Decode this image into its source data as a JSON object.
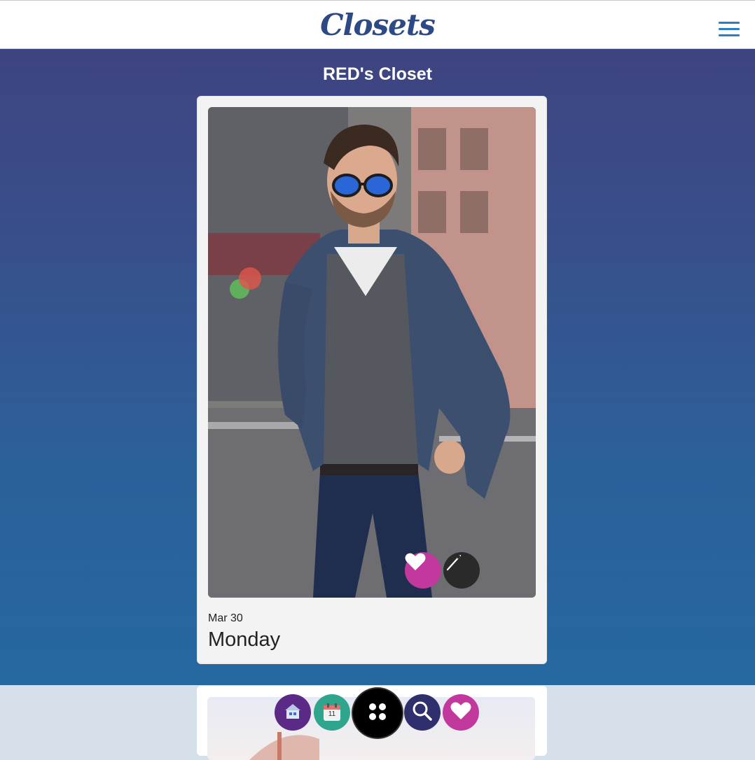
{
  "header": {
    "logo_text": "Closets",
    "menu_icon": "hamburger-icon"
  },
  "closet": {
    "title": "RED's Closet"
  },
  "outfit": {
    "photo_icon": "outfit-photo",
    "like_icon": "heart-icon",
    "edit_icon": "needle-icon",
    "date": "Mar 30",
    "day": "Monday"
  },
  "dock": {
    "items": [
      {
        "icon": "home-icon"
      },
      {
        "icon": "calendar-icon",
        "label": "11"
      },
      {
        "icon": "apps-icon"
      },
      {
        "icon": "search-icon"
      },
      {
        "icon": "heart-icon"
      }
    ]
  },
  "colors": {
    "gradient_top": "#3e4480",
    "gradient_bottom": "#2568a0",
    "accent_pink": "#c2399e",
    "logo_blue": "#2e4a86",
    "menu_blue": "#2c7fc1"
  }
}
